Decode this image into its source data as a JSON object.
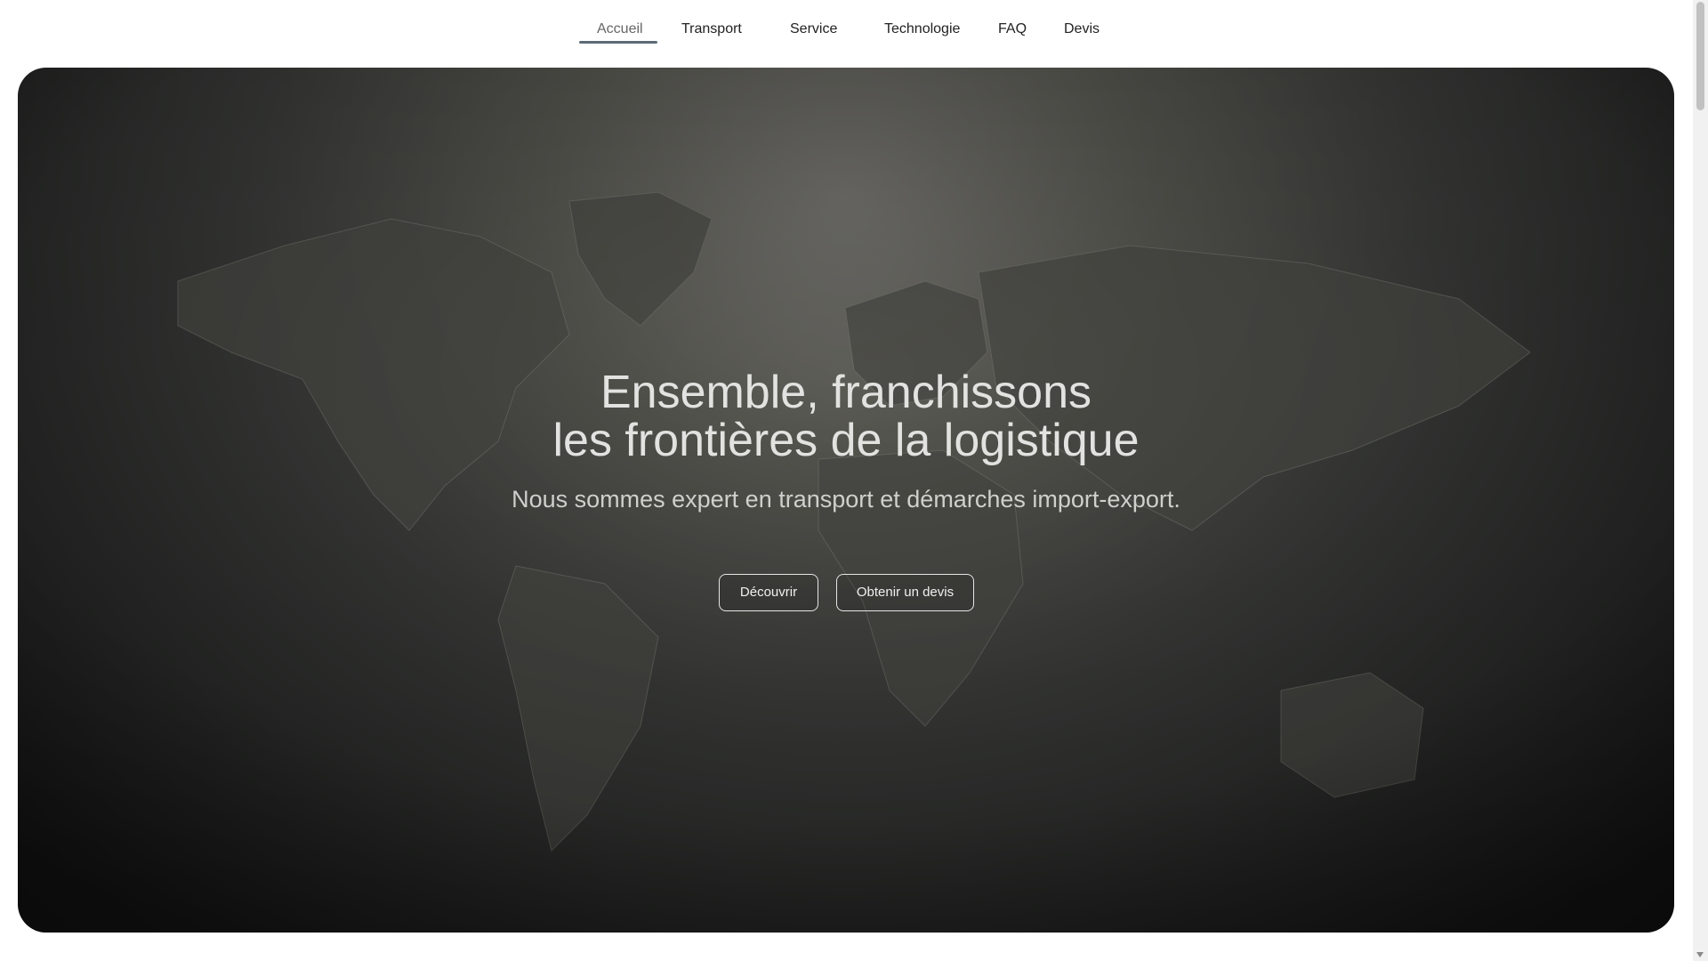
{
  "nav": {
    "items": [
      {
        "label": "Accueil",
        "active": true
      },
      {
        "label": "Transport",
        "active": false
      },
      {
        "label": "Service",
        "active": false
      },
      {
        "label": "Technologie",
        "active": false
      },
      {
        "label": "FAQ",
        "active": false
      },
      {
        "label": "Devis",
        "active": false
      }
    ]
  },
  "hero": {
    "title_line1": "Ensemble, franchissons",
    "title_line2": "les frontières de la logistique",
    "subtitle": "Nous sommes expert en transport et démarches import-export.",
    "discover_button": "Découvrir",
    "quote_button": "Obtenir un devis",
    "background": "world-map",
    "colors": {
      "background_dark": "#1a1a1a",
      "background_light": "#6e6d69",
      "text": "#e2e2e0"
    }
  },
  "colors": {
    "nav_underline": "#5b6b75"
  }
}
